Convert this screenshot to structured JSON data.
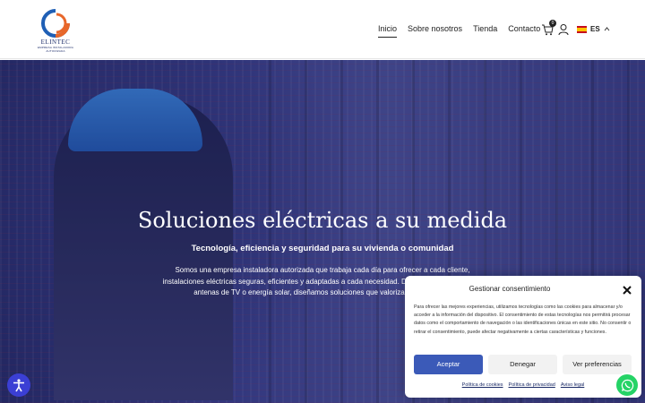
{
  "logo": {
    "brand": "ELINTEC",
    "tagline": "EMPRESA INSTALADORA AUTORIZADA"
  },
  "nav": {
    "items": [
      "Inicio",
      "Sobre nosotros",
      "Tienda",
      "Contacto"
    ],
    "active": "Inicio"
  },
  "cart": {
    "count": "0"
  },
  "language": {
    "code": "ES"
  },
  "hero": {
    "title": "Soluciones eléctricas a su medida",
    "subtitle": "Tecnología, eficiencia y seguridad para su vivienda o comunidad",
    "text": "Somos una empresa instaladora autorizada que trabaja cada día para ofrecer a cada cliente, instalaciones eléctricas seguras, eficientes y adaptadas a cada necesidad. Desde baja tensión hasta antenas de TV o energía solar, diseñamos soluciones que valorizan su inmueble."
  },
  "consent": {
    "title": "Gestionar consentimiento",
    "body": "Para ofrecer las mejores experiencias, utilizamos tecnologías como las cookies para almacenar y/o acceder a la información del dispositivo. El consentimiento de estas tecnologías nos permitirá procesar datos como el comportamiento de navegación o las identificaciones únicas en este sitio. No consentir o retirar el consentimiento, puede afectar negativamente a ciertas características y funciones.",
    "accept": "Aceptar",
    "deny": "Denegar",
    "prefs": "Ver preferencias",
    "links": [
      "Política de cookies",
      "Política de privacidad",
      "Aviso legal"
    ]
  },
  "colors": {
    "accent": "#3b5ab8",
    "nav_text": "#222222",
    "whatsapp": "#25d366",
    "accessibility": "#3b3fd4"
  }
}
